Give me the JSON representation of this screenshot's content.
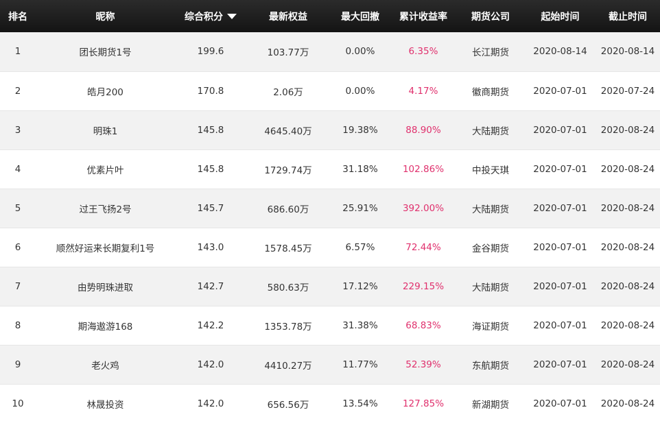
{
  "colors": {
    "header_bg": "#1a1a1a",
    "header_text": "#ffffff",
    "row_alt": "#f2f2f2",
    "return_text": "#e0306d"
  },
  "headers": {
    "rank": "排名",
    "nickname": "昵称",
    "score": "综合积分",
    "equity": "最新权益",
    "drawdown": "最大回撤",
    "return": "累计收益率",
    "company": "期货公司",
    "start": "起始时间",
    "end": "截止时间",
    "sort_icon": "caret-down-icon"
  },
  "rows": [
    {
      "rank": "1",
      "nickname": "团长期货1号",
      "score": "199.6",
      "equity": "103.77万",
      "drawdown": "0.00%",
      "return": "6.35%",
      "company": "长江期货",
      "start": "2020-08-14",
      "end": "2020-08-14"
    },
    {
      "rank": "2",
      "nickname": "皓月200",
      "score": "170.8",
      "equity": "2.06万",
      "drawdown": "0.00%",
      "return": "4.17%",
      "company": "徽商期货",
      "start": "2020-07-01",
      "end": "2020-07-24"
    },
    {
      "rank": "3",
      "nickname": "明珠1",
      "score": "145.8",
      "equity": "4645.40万",
      "drawdown": "19.38%",
      "return": "88.90%",
      "company": "大陆期货",
      "start": "2020-07-01",
      "end": "2020-08-24"
    },
    {
      "rank": "4",
      "nickname": "优素片叶",
      "score": "145.8",
      "equity": "1729.74万",
      "drawdown": "31.18%",
      "return": "102.86%",
      "company": "中投天琪",
      "start": "2020-07-01",
      "end": "2020-08-24"
    },
    {
      "rank": "5",
      "nickname": "过王飞扬2号",
      "score": "145.7",
      "equity": "686.60万",
      "drawdown": "25.91%",
      "return": "392.00%",
      "company": "大陆期货",
      "start": "2020-07-01",
      "end": "2020-08-24"
    },
    {
      "rank": "6",
      "nickname": "顺然好运来长期复利1号",
      "score": "143.0",
      "equity": "1578.45万",
      "drawdown": "6.57%",
      "return": "72.44%",
      "company": "金谷期货",
      "start": "2020-07-01",
      "end": "2020-08-24"
    },
    {
      "rank": "7",
      "nickname": "由势明珠进取",
      "score": "142.7",
      "equity": "580.63万",
      "drawdown": "17.12%",
      "return": "229.15%",
      "company": "大陆期货",
      "start": "2020-07-01",
      "end": "2020-08-24"
    },
    {
      "rank": "8",
      "nickname": "期海遨游168",
      "score": "142.2",
      "equity": "1353.78万",
      "drawdown": "31.38%",
      "return": "68.83%",
      "company": "海证期货",
      "start": "2020-07-01",
      "end": "2020-08-24"
    },
    {
      "rank": "9",
      "nickname": "老火鸡",
      "score": "142.0",
      "equity": "4410.27万",
      "drawdown": "11.77%",
      "return": "52.39%",
      "company": "东航期货",
      "start": "2020-07-01",
      "end": "2020-08-24"
    },
    {
      "rank": "10",
      "nickname": "林晟投资",
      "score": "142.0",
      "equity": "656.56万",
      "drawdown": "13.54%",
      "return": "127.85%",
      "company": "新湖期货",
      "start": "2020-07-01",
      "end": "2020-08-24"
    }
  ]
}
